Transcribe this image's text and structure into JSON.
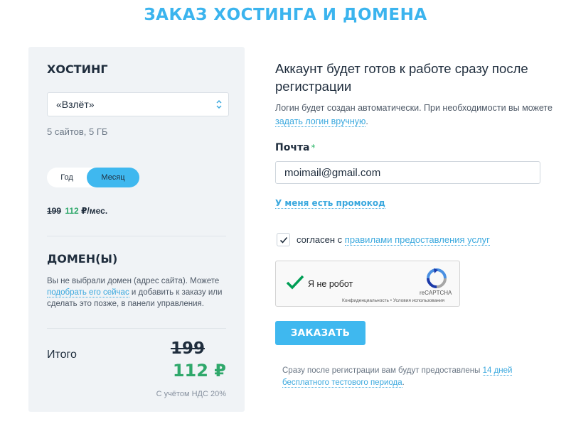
{
  "page_title": "ЗАКАЗ ХОСТИНГА И ДОМЕНА",
  "hosting": {
    "title": "ХОСТИНГ",
    "selected_plan": "«Взлёт»",
    "plan_description": "5 сайтов, 5 ГБ",
    "period": {
      "year_label": "Год",
      "month_label": "Месяц",
      "selected": "Месяц"
    },
    "old_price": "199",
    "new_price": "112",
    "price_unit": " ₽/мес."
  },
  "domain": {
    "title": "ДОМЕН(Ы)",
    "text_before": "Вы не выбрали домен (адрес сайта). Можете ",
    "link": "подобрать его сейчас",
    "text_after": " и добавить к заказу или сделать это позже, в панели управления."
  },
  "total": {
    "label": "Итого",
    "old": "199",
    "new": "112 ₽",
    "vat_note": "С учётом НДС 20%"
  },
  "form": {
    "heading": "Аккаунт будет готов к работе сразу после регистрации",
    "login_note_before": "Логин будет создан автоматически. При необходимости вы можете ",
    "login_note_link": "задать логин вручную",
    "login_note_after": ".",
    "email_label": "Почта",
    "required_mark": "*",
    "email_value": "moimail@gmail.com",
    "promo_link": "У меня есть промокод",
    "agree_checked": true,
    "agree_text": "согласен с ",
    "agree_link": "правилами предоставления услуг",
    "captcha": {
      "label": "Я не робот",
      "brand": "reCAPTCHA",
      "terms": "Конфиденциальность • Условия использования"
    },
    "order_button": "ЗАКАЗАТЬ",
    "trial_before": "Сразу после регистрации вам будут предоставлены ",
    "trial_link": "14 дней бесплатного тестового периода",
    "trial_after": "."
  },
  "colors": {
    "accent": "#3fb8ef",
    "title": "#3bb4ee",
    "price_green": "#2fa86b",
    "panel_bg": "#f0f3f6"
  }
}
